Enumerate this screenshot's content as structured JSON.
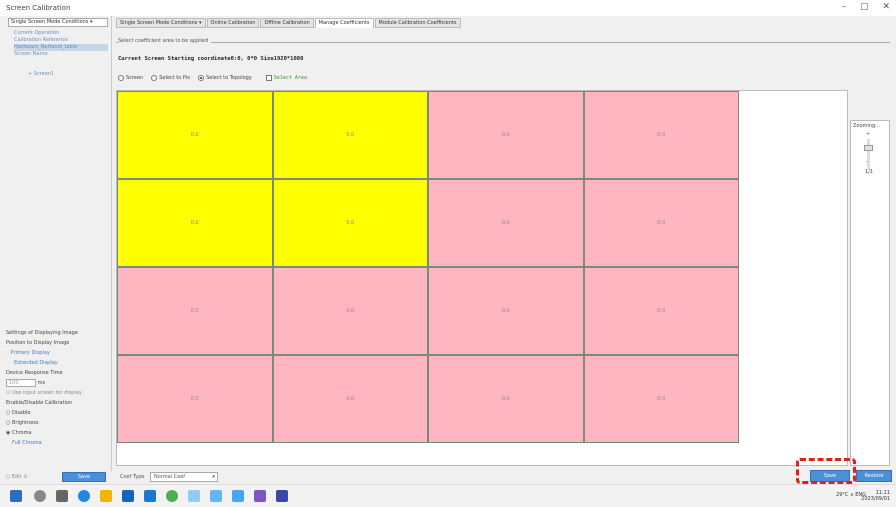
{
  "window": {
    "title": "Screen Calibration"
  },
  "left": {
    "combo": "Single Screen Mode  Conditions  ▾",
    "tree": [
      "Current Operation",
      "Calibration Reference",
      "Hardware_NeHandl_table",
      "Screen Name"
    ],
    "tree_child": "+ Screen1"
  },
  "settings": {
    "title": "Settings of Displaying Image",
    "position_label": "Position to Display Image",
    "primary": "◦ Primary Display",
    "extended": "Extended Display",
    "delay_label": "Device Response Time",
    "delay_value": "100",
    "delay_unit": "ms",
    "checkbox_text": "☐ Use input screen for display",
    "group_title": "Enable/Disable Calibration",
    "opt1": "○ Disable",
    "opt2": "○ Brightness",
    "opt3": "◉ Chroma",
    "opt4": "Full Chroma",
    "left_label": "○ Edit ⊙",
    "left_button": "Save"
  },
  "tabs": [
    "Single Screen Mode  Conditions  ▾",
    "Online Calibration",
    "Offline Calibration",
    "Manage Coefficients",
    "Module Calibration Coefficients"
  ],
  "section_label": "Select coefficient area to be applied",
  "current_screen": "Current Screen  Starting coordinate0:0,  0*0   Size1920*1080",
  "radios": {
    "r1": "Screen",
    "r2": "Select to Pix",
    "r3": "Select to Topology",
    "chk": "Select Area"
  },
  "grid": {
    "cells": [
      {
        "label": "0,0",
        "color": "#ffff00"
      },
      {
        "label": "0,0",
        "color": "#ffff00"
      },
      {
        "label": "0,0",
        "color": "#ffb6c1"
      },
      {
        "label": "0,0",
        "color": "#ffb6c1"
      },
      {
        "label": "0,0",
        "color": "#ffff00"
      },
      {
        "label": "0,0",
        "color": "#ffff00"
      },
      {
        "label": "0,0",
        "color": "#ffb6c1"
      },
      {
        "label": "0,0",
        "color": "#ffb6c1"
      },
      {
        "label": "0,0",
        "color": "#ffb6c1"
      },
      {
        "label": "0,0",
        "color": "#ffb6c1"
      },
      {
        "label": "0,0",
        "color": "#ffb6c1"
      },
      {
        "label": "0,0",
        "color": "#ffb6c1"
      },
      {
        "label": "0,0",
        "color": "#ffb6c1"
      },
      {
        "label": "0,0",
        "color": "#ffb6c1"
      },
      {
        "label": "0,0",
        "color": "#ffb6c1"
      },
      {
        "label": "0,0",
        "color": "#ffb6c1"
      }
    ]
  },
  "zoom": {
    "header": "Zooming...",
    "plus": "+",
    "minus": "-",
    "value": "1/1"
  },
  "bottom": {
    "coef_label": "Coef Type",
    "coef_value": "Normal Coef",
    "btn_save": "Save",
    "btn_restore": "Restore"
  },
  "tray": {
    "text": "29°C  ∧  ENG",
    "time": "11:11",
    "date": "2023/09/01"
  },
  "colors": {
    "accent": "#4a8fd8",
    "highlight": "#e02020",
    "yellow": "#ffff00",
    "pink": "#ffb6c1"
  }
}
